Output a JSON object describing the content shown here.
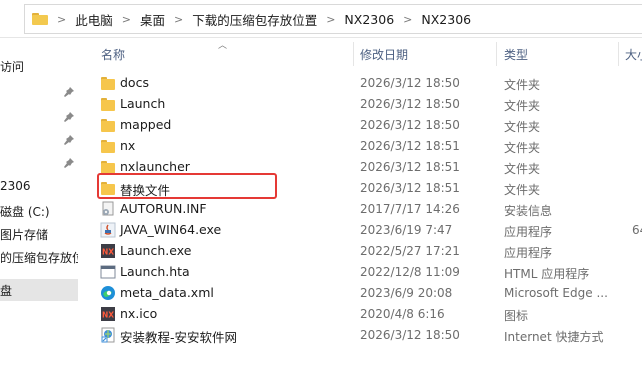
{
  "breadcrumb": [
    "此电脑",
    "桌面",
    "下载的压缩包存放位置",
    "NX2306",
    "NX2306"
  ],
  "nav": {
    "items": [
      "访问",
      "2306",
      "磁盘 (C:)",
      "图片存储",
      "的压缩包存放位",
      "盘"
    ],
    "selected_index": 5
  },
  "columns": {
    "name": "名称",
    "date": "修改日期",
    "type": "类型",
    "size": "大小"
  },
  "files": [
    {
      "name": "docs",
      "date": "2026/3/12 18:50",
      "type": "文件夹",
      "size": "",
      "icon": "folder-icon"
    },
    {
      "name": "Launch",
      "date": "2026/3/12 18:50",
      "type": "文件夹",
      "size": "",
      "icon": "folder-icon"
    },
    {
      "name": "mapped",
      "date": "2026/3/12 18:50",
      "type": "文件夹",
      "size": "",
      "icon": "folder-icon"
    },
    {
      "name": "nx",
      "date": "2026/3/12 18:51",
      "type": "文件夹",
      "size": "",
      "icon": "folder-icon"
    },
    {
      "name": "nxlauncher",
      "date": "2026/3/12 18:51",
      "type": "文件夹",
      "size": "",
      "icon": "folder-icon"
    },
    {
      "name": "替换文件",
      "date": "2026/3/12 18:51",
      "type": "文件夹",
      "size": "",
      "icon": "folder-icon"
    },
    {
      "name": "AUTORUN.INF",
      "date": "2017/7/17 14:26",
      "type": "安装信息",
      "size": "",
      "icon": "setup-info-icon"
    },
    {
      "name": "JAVA_WIN64.exe",
      "date": "2023/6/19 7:47",
      "type": "应用程序",
      "size": "64",
      "icon": "java-icon"
    },
    {
      "name": "Launch.exe",
      "date": "2022/5/27 17:21",
      "type": "应用程序",
      "size": "",
      "icon": "nx-app-icon"
    },
    {
      "name": "Launch.hta",
      "date": "2022/12/8 11:09",
      "type": "HTML 应用程序",
      "size": "",
      "icon": "hta-icon"
    },
    {
      "name": "meta_data.xml",
      "date": "2023/6/9 20:08",
      "type": "Microsoft Edge ...",
      "size": "",
      "icon": "edge-icon"
    },
    {
      "name": "nx.ico",
      "date": "2020/4/8 6:16",
      "type": "图标",
      "size": "",
      "icon": "nx-ico-icon"
    },
    {
      "name": "安装教程-安安软件网",
      "date": "2026/3/12 18:50",
      "type": "Internet 快捷方式",
      "size": "",
      "icon": "internet-shortcut-icon"
    }
  ],
  "colors": {
    "folder": "#f6c64c",
    "highlight": "#e53935",
    "header_text": "#4d6082",
    "nav_selected": "#e5e5e5"
  }
}
